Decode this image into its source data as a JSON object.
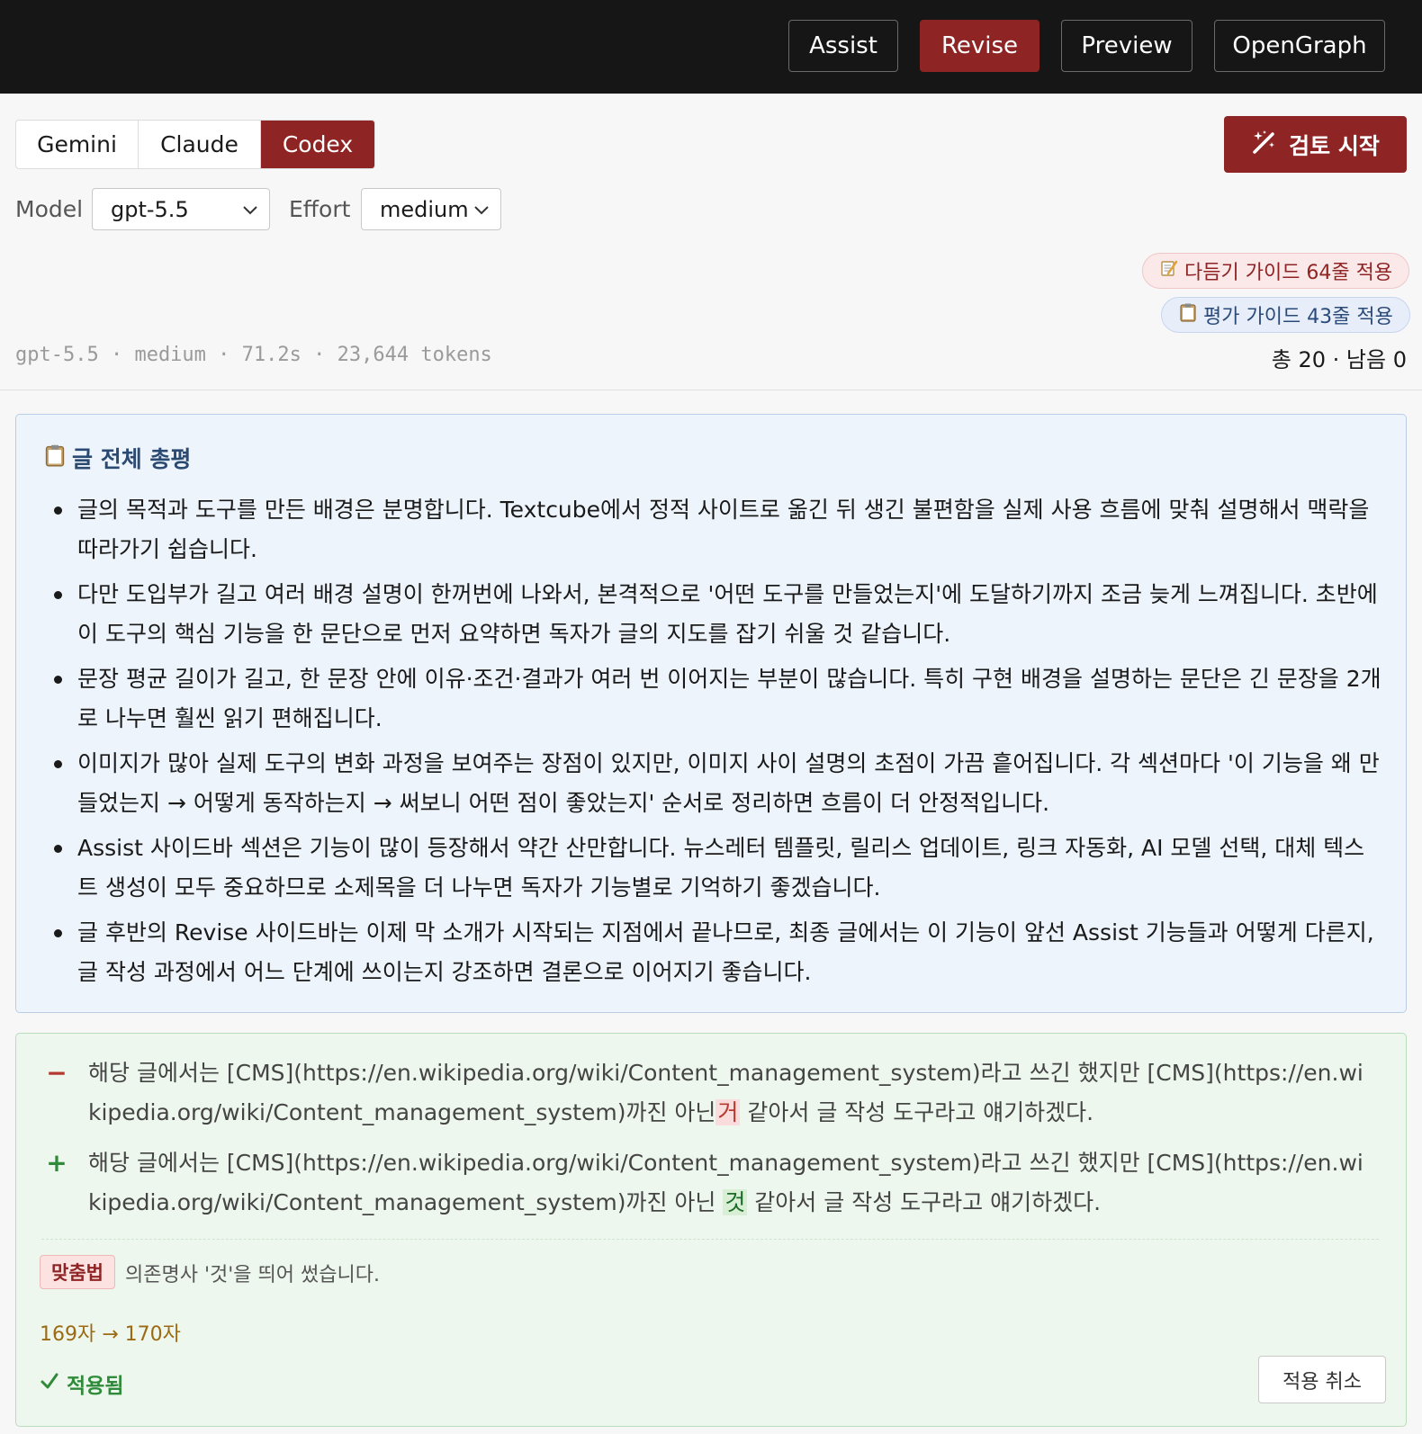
{
  "topbar": {
    "buttons": [
      {
        "label": "Assist",
        "active": false
      },
      {
        "label": "Revise",
        "active": true
      },
      {
        "label": "Preview",
        "active": false
      },
      {
        "label": "OpenGraph",
        "active": false
      }
    ]
  },
  "provider_tabs": [
    {
      "label": "Gemini",
      "active": false
    },
    {
      "label": "Claude",
      "active": false
    },
    {
      "label": "Codex",
      "active": true
    }
  ],
  "start_button": {
    "label": "검토 시작",
    "icon": "magic-wand-icon"
  },
  "model": {
    "label": "Model",
    "value": "gpt-5.5"
  },
  "effort": {
    "label": "Effort",
    "value": "medium"
  },
  "guides": {
    "polish": {
      "icon": "memo-icon",
      "text": "다듬기 가이드 64줄 적용"
    },
    "eval": {
      "icon": "clipboard-icon",
      "text": "평가 가이드 43줄 적용"
    }
  },
  "run_meta": "gpt-5.5 · medium · 71.2s · 23,644 tokens",
  "counts": "총 20 · 남음 0",
  "summary": {
    "icon": "clipboard-icon",
    "title": "글 전체 총평",
    "items": [
      "글의 목적과 도구를 만든 배경은 분명합니다. Textcube에서 정적 사이트로 옮긴 뒤 생긴 불편함을 실제 사용 흐름에 맞춰 설명해서 맥락을 따라가기 쉽습니다.",
      "다만 도입부가 길고 여러 배경 설명이 한꺼번에 나와서, 본격적으로 '어떤 도구를 만들었는지'에 도달하기까지 조금 늦게 느껴집니다. 초반에 이 도구의 핵심 기능을 한 문단으로 먼저 요약하면 독자가 글의 지도를 잡기 쉬울 것 같습니다.",
      "문장 평균 길이가 길고, 한 문장 안에 이유·조건·결과가 여러 번 이어지는 부분이 많습니다. 특히 구현 배경을 설명하는 문단은 긴 문장을 2개로 나누면 훨씬 읽기 편해집니다.",
      "이미지가 많아 실제 도구의 변화 과정을 보여주는 장점이 있지만, 이미지 사이 설명의 초점이 가끔 흩어집니다. 각 섹션마다 '이 기능을 왜 만들었는지 → 어떻게 동작하는지 → 써보니 어떤 점이 좋았는지' 순서로 정리하면 흐름이 더 안정적입니다.",
      "Assist 사이드바 섹션은 기능이 많이 등장해서 약간 산만합니다. 뉴스레터 템플릿, 릴리스 업데이트, 링크 자동화, AI 모델 선택, 대체 텍스트 생성이 모두 중요하므로 소제목을 더 나누면 독자가 기능별로 기억하기 좋겠습니다.",
      "글 후반의 Revise 사이드바는 이제 막 소개가 시작되는 지점에서 끝나므로, 최종 글에서는 이 기능이 앞선 Assist 기능들과 어떻게 다른지, 글 작성 과정에서 어느 단계에 쓰이는지 강조하면 결론으로 이어지기 좋습니다."
    ]
  },
  "change": {
    "removed": {
      "sign": "−",
      "before": "해당 글에서는 [CMS](https://en.wikipedia.org/wiki/Content_management_system)라고 쓰긴 했지만 [CMS](https://en.wikipedia.org/wiki/Content_management_system)까진 아닌",
      "highlight": "거",
      "after": " 같아서 글 작성 도구라고 얘기하겠다."
    },
    "added": {
      "sign": "+",
      "before": "해당 글에서는 [CMS](https://en.wikipedia.org/wiki/Content_management_system)라고 쓰긴 했지만 [CMS](https://en.wikipedia.org/wiki/Content_management_system)까진 아닌 ",
      "highlight": "것",
      "after": " 같아서 글 작성 도구라고 얘기하겠다."
    },
    "tag": "맞춤법",
    "reason": "의존명사 '것'을 띄어 썼습니다.",
    "length_change": "169자 → 170자",
    "status": "적용됨",
    "undo_label": "적용 취소"
  }
}
